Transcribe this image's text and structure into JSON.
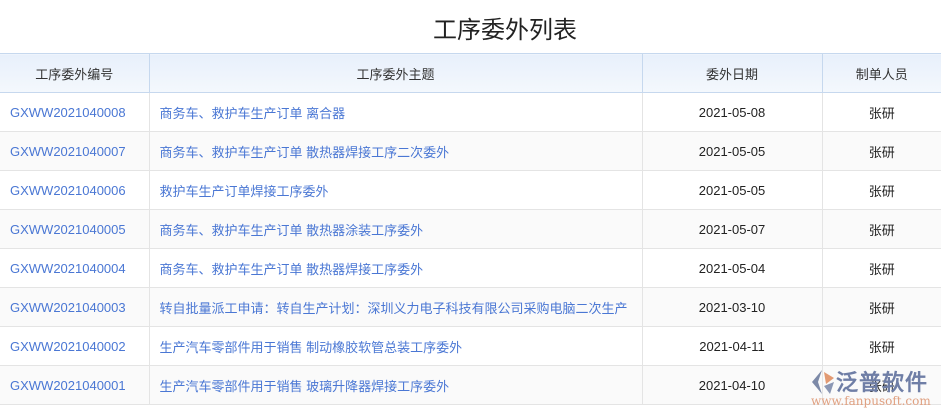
{
  "title": "工序委外列表",
  "columns": [
    "工序委外编号",
    "工序委外主题",
    "委外日期",
    "制单人员"
  ],
  "rows": [
    {
      "code": "GXWW2021040008",
      "subject": "商务车、救护车生产订单 离合器",
      "date": "2021-05-08",
      "creator": "张研"
    },
    {
      "code": "GXWW2021040007",
      "subject": "商务车、救护车生产订单 散热器焊接工序二次委外",
      "date": "2021-05-05",
      "creator": "张研"
    },
    {
      "code": "GXWW2021040006",
      "subject": "救护车生产订单焊接工序委外",
      "date": "2021-05-05",
      "creator": "张研"
    },
    {
      "code": "GXWW2021040005",
      "subject": "商务车、救护车生产订单 散热器涂装工序委外",
      "date": "2021-05-07",
      "creator": "张研"
    },
    {
      "code": "GXWW2021040004",
      "subject": "商务车、救护车生产订单 散热器焊接工序委外",
      "date": "2021-05-04",
      "creator": "张研"
    },
    {
      "code": "GXWW2021040003",
      "subject": "转自批量派工申请：转自生产计划：深圳义力电子科技有限公司采购电脑二次生产",
      "date": "2021-03-10",
      "creator": "张研"
    },
    {
      "code": "GXWW2021040002",
      "subject": "生产汽车零部件用于销售 制动橡胶软管总装工序委外",
      "date": "2021-04-11",
      "creator": "张研"
    },
    {
      "code": "GXWW2021040001",
      "subject": "生产汽车零部件用于销售 玻璃升降器焊接工序委外",
      "date": "2021-04-10",
      "creator": "张研"
    }
  ],
  "watermark": {
    "brand": "泛普软件",
    "url": "www.fanpusoft.com"
  }
}
